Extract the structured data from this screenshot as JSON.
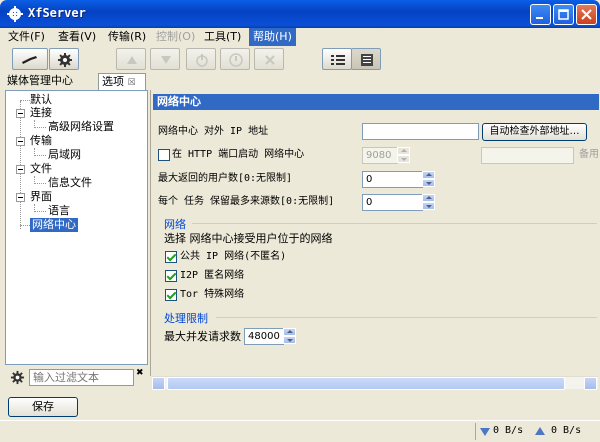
{
  "window": {
    "title": "XfServer"
  },
  "menu": [
    {
      "label": "文件(F)",
      "disabled": false,
      "active": false
    },
    {
      "label": "查看(V)",
      "disabled": false,
      "active": false
    },
    {
      "label": "传输(R)",
      "disabled": false,
      "active": false
    },
    {
      "label": "控制(O)",
      "disabled": true,
      "active": false
    },
    {
      "label": "工具(T)",
      "disabled": false,
      "active": false
    },
    {
      "label": "帮助(H)",
      "disabled": false,
      "active": true
    }
  ],
  "left_tabs": {
    "tab1": "媒体管理中心",
    "tab2": "选项"
  },
  "tree": {
    "default": "默认",
    "connection": "连接",
    "advanced_network": "高级网络设置",
    "transfer": "传输",
    "lan": "局域网",
    "file": "文件",
    "file_info": "信息文件",
    "ui": "界面",
    "language": "语言",
    "network_center": "网络中心"
  },
  "filter": {
    "placeholder": "输入过滤文本"
  },
  "save_button": "保存",
  "panel": {
    "header": "网络中心",
    "external_ip_label": "网络中心 对外 IP 地址",
    "external_ip_value": "",
    "auto_detect_button": "自动检查外部地址…",
    "http_port_label": "在 HTTP 端口启动 网络中心",
    "http_port_value": "9080",
    "http_extra_label": "备用",
    "max_users_label": "最大返回的用户数[0:无限制]",
    "max_users_value": "0",
    "max_sources_label": "每个 任务 保留最多来源数[0:无限制]",
    "max_sources_value": "0",
    "network_group_title": "网络",
    "network_desc": "选择 网络中心接受用户位于的网络",
    "public_ip": "公共 IP 网络(不匿名)",
    "i2p": "I2P 匿名网络",
    "tor": "Tor 特殊网络",
    "limit_group_title": "处理限制",
    "max_requests_label": "最大并发请求数",
    "max_requests_value": "48000"
  },
  "checks": {
    "http_port": false,
    "public_ip": true,
    "i2p": true,
    "tor": true
  },
  "status": {
    "download_rate": "0 B/s",
    "upload_rate": "0 B/s"
  },
  "colors": {
    "titlebar": "#0542c2",
    "selection": "#316ac5",
    "accent_text": "#0046d5"
  },
  "icons": {
    "title": "gear-icon",
    "toolbar_connect": "plug-icon",
    "toolbar_settings": "gear-icon",
    "toolbar_up": "triangle-up-icon",
    "toolbar_down": "triangle-down-icon",
    "toolbar_power": "power-icon",
    "toolbar_stop": "stop-icon",
    "toolbar_clear": "x-icon",
    "view_list": "list-view-icon",
    "view_detail": "detail-view-icon"
  }
}
